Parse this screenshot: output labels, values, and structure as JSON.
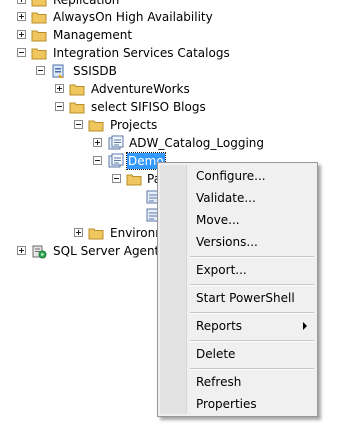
{
  "tree": {
    "replication": "Replication",
    "alwayson": "AlwaysOn High Availability",
    "management": "Management",
    "integration_services": "Integration Services Catalogs",
    "ssisdb": "SSISDB",
    "adventureworks": "AdventureWorks",
    "sifiso_blogs": "select SIFISO Blogs",
    "projects": "Projects",
    "adw_catalog_logging": "ADW_Catalog_Logging",
    "demo": "Demo",
    "packages_partial": "Pa",
    "environments_partial": "Environm",
    "sql_server_agent": "SQL Server Agent"
  },
  "context_menu": {
    "configure": "Configure...",
    "validate": "Validate...",
    "move": "Move...",
    "versions": "Versions...",
    "export": "Export...",
    "start_powershell": "Start PowerShell",
    "reports": "Reports",
    "delete": "Delete",
    "refresh": "Refresh",
    "properties": "Properties"
  }
}
